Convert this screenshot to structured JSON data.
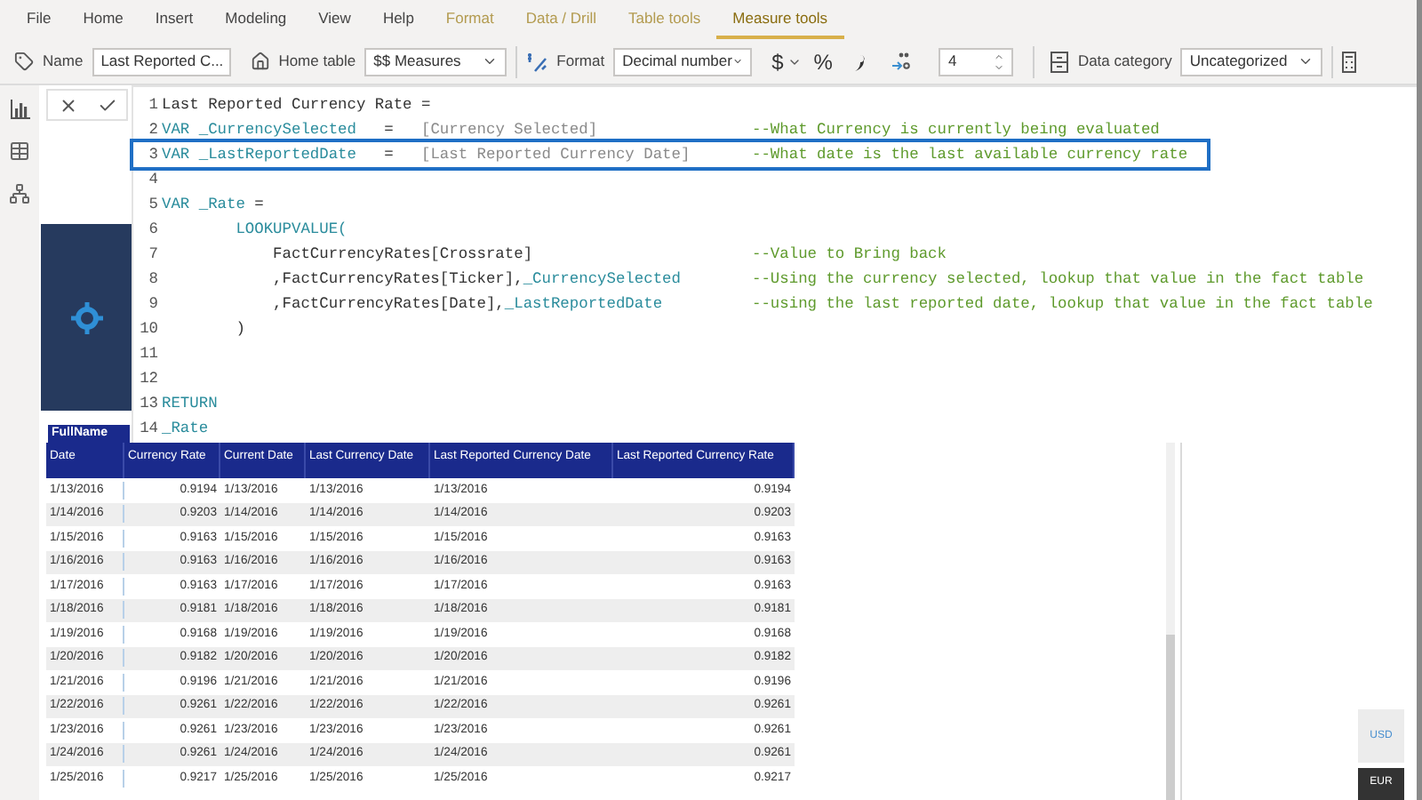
{
  "menu_tabs": [
    {
      "label": "File",
      "kind": "main",
      "selected": false
    },
    {
      "label": "Home",
      "kind": "main",
      "selected": false
    },
    {
      "label": "Insert",
      "kind": "main",
      "selected": false
    },
    {
      "label": "Modeling",
      "kind": "main",
      "selected": false
    },
    {
      "label": "View",
      "kind": "main",
      "selected": false
    },
    {
      "label": "Help",
      "kind": "main",
      "selected": false
    },
    {
      "label": "Format",
      "kind": "contextual",
      "selected": false
    },
    {
      "label": "Data / Drill",
      "kind": "contextual",
      "selected": false
    },
    {
      "label": "Table tools",
      "kind": "contextual",
      "selected": false
    },
    {
      "label": "Measure tools",
      "kind": "contextual",
      "selected": true
    }
  ],
  "toolbar": {
    "name_label": "Name",
    "name_value": "Last Reported C...",
    "home_table_label": "Home table",
    "home_table_value": "$$ Measures",
    "format_label": "Format",
    "format_value": "Decimal number",
    "currency_symbol": "$",
    "percent_symbol": "%",
    "decimals_value": "4",
    "data_category_label": "Data category",
    "data_category_value": "Uncategorized"
  },
  "code_lines": [
    {
      "number": "1",
      "highlighted": false,
      "tokens": [
        {
          "kind": "text",
          "text": "Last Reported Currency Rate ="
        }
      ]
    },
    {
      "number": "2",
      "highlighted": false,
      "tokens": [
        {
          "kind": "keyword",
          "text": "VAR"
        },
        {
          "kind": "variable",
          "text": " _CurrencySelected"
        },
        {
          "kind": "text",
          "text": "   =   "
        },
        {
          "kind": "measure",
          "text": "[Currency Selected]"
        }
      ],
      "comment": "--What Currency is currently being evaluated"
    },
    {
      "number": "3",
      "highlighted": true,
      "tokens": [
        {
          "kind": "keyword",
          "text": "VAR"
        },
        {
          "kind": "variable",
          "text": " _LastReportedDate"
        },
        {
          "kind": "text",
          "text": "   =   "
        },
        {
          "kind": "measure",
          "text": "[Last Reported Currency Date]"
        }
      ],
      "comment": "--What date is the last available currency rate"
    },
    {
      "number": "4",
      "highlighted": false
    },
    {
      "number": "5",
      "highlighted": false,
      "tokens": [
        {
          "kind": "keyword",
          "text": "VAR"
        },
        {
          "kind": "variable",
          "text": " _Rate"
        },
        {
          "kind": "text",
          "text": " ="
        }
      ]
    },
    {
      "number": "6",
      "highlighted": false,
      "tokens": [
        {
          "kind": "keyword",
          "text": "        LOOKUPVALUE("
        }
      ]
    },
    {
      "number": "7",
      "highlighted": false,
      "tokens": [
        {
          "kind": "text",
          "text": "            FactCurrencyRates[Crossrate]"
        }
      ],
      "comment": "--Value to Bring back"
    },
    {
      "number": "8",
      "highlighted": false,
      "tokens": [
        {
          "kind": "text",
          "text": "            ,FactCurrencyRates[Ticker],"
        },
        {
          "kind": "variable",
          "text": "_CurrencySelected"
        }
      ],
      "comment": "--Using the currency selected, lookup that value in the fact table"
    },
    {
      "number": "9",
      "highlighted": false,
      "tokens": [
        {
          "kind": "text",
          "text": "            ,FactCurrencyRates[Date],"
        },
        {
          "kind": "variable",
          "text": "_LastReportedDate"
        }
      ],
      "comment": "--using the last reported date, lookup that value in the fact table"
    },
    {
      "number": "10",
      "highlighted": false,
      "tokens": [
        {
          "kind": "text",
          "text": "        )"
        }
      ]
    },
    {
      "number": "11",
      "highlighted": false
    },
    {
      "number": "12",
      "highlighted": false
    },
    {
      "number": "13",
      "highlighted": false,
      "tokens": [
        {
          "kind": "keyword",
          "text": "RETURN"
        }
      ]
    },
    {
      "number": "14",
      "highlighted": false,
      "tokens": [
        {
          "kind": "variable",
          "text": "_Rate"
        }
      ]
    }
  ],
  "table": {
    "title": "FullName",
    "columns": [
      "Date",
      "Currency Rate",
      "Current Date",
      "Last Currency Date",
      "Last Reported Currency Date",
      "Last Reported Currency Rate"
    ],
    "rows": [
      [
        "1/13/2016",
        "0.9194",
        "1/13/2016",
        "1/13/2016",
        "1/13/2016",
        "0.9194"
      ],
      [
        "1/14/2016",
        "0.9203",
        "1/14/2016",
        "1/14/2016",
        "1/14/2016",
        "0.9203"
      ],
      [
        "1/15/2016",
        "0.9163",
        "1/15/2016",
        "1/15/2016",
        "1/15/2016",
        "0.9163"
      ],
      [
        "1/16/2016",
        "0.9163",
        "1/16/2016",
        "1/16/2016",
        "1/16/2016",
        "0.9163"
      ],
      [
        "1/17/2016",
        "0.9163",
        "1/17/2016",
        "1/17/2016",
        "1/17/2016",
        "0.9163"
      ],
      [
        "1/18/2016",
        "0.9181",
        "1/18/2016",
        "1/18/2016",
        "1/18/2016",
        "0.9181"
      ],
      [
        "1/19/2016",
        "0.9168",
        "1/19/2016",
        "1/19/2016",
        "1/19/2016",
        "0.9168"
      ],
      [
        "1/20/2016",
        "0.9182",
        "1/20/2016",
        "1/20/2016",
        "1/20/2016",
        "0.9182"
      ],
      [
        "1/21/2016",
        "0.9196",
        "1/21/2016",
        "1/21/2016",
        "1/21/2016",
        "0.9196"
      ],
      [
        "1/22/2016",
        "0.9261",
        "1/22/2016",
        "1/22/2016",
        "1/22/2016",
        "0.9261"
      ],
      [
        "1/23/2016",
        "0.9261",
        "1/23/2016",
        "1/23/2016",
        "1/23/2016",
        "0.9261"
      ],
      [
        "1/24/2016",
        "0.9261",
        "1/24/2016",
        "1/24/2016",
        "1/24/2016",
        "0.9261"
      ],
      [
        "1/25/2016",
        "0.9217",
        "1/25/2016",
        "1/25/2016",
        "1/25/2016",
        "0.9217"
      ]
    ]
  },
  "currency_slicer": [
    {
      "label": "USD",
      "selected": false
    },
    {
      "label": "EUR",
      "selected": true
    }
  ]
}
